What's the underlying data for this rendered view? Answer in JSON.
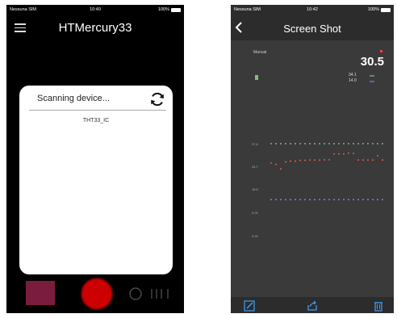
{
  "left_phone": {
    "status": {
      "carrier": "Nessuna SIM",
      "time": "10:40",
      "battery": "100%"
    },
    "title": "HTMercury33",
    "dialog": {
      "title": "Scanning device...",
      "devices": [
        "THT33_IC"
      ]
    },
    "icons": [
      "menu-icon",
      "refresh-icon",
      "record-icon"
    ]
  },
  "right_phone": {
    "status": {
      "carrier": "Nessuna SIM",
      "time": "10:42",
      "battery": "100%"
    },
    "title": "Screen Shot",
    "mode": "Manual",
    "readout": {
      "main": "30.5",
      "secondary": [
        "34.1",
        "14.0"
      ]
    },
    "y_ticks": [
      "37.6",
      "34.7",
      "18.8",
      "0.00",
      "0.00"
    ],
    "series": [
      {
        "name": "green",
        "color": "#8fd88f",
        "values": [
          37.6,
          37.6,
          37.6,
          37.6,
          37.6,
          37.6,
          37.6,
          37.6,
          37.6,
          37.6,
          37.6,
          37.6,
          37.6,
          37.6,
          37.6,
          37.6,
          37.6,
          37.6,
          37.6,
          37.6,
          37.6,
          37.6,
          37.6,
          37.6
        ]
      },
      {
        "name": "red",
        "color": "#ff6060",
        "values": [
          30.4,
          29.9,
          28.2,
          30.8,
          31.1,
          31.1,
          31.4,
          31.4,
          31.5,
          31.5,
          31.5,
          31.6,
          31.6,
          33.8,
          33.8,
          33.8,
          34.1,
          34.0,
          31.5,
          31.5,
          31.5,
          31.5,
          33.1,
          31.5
        ]
      },
      {
        "name": "blue",
        "color": "#8c8cff",
        "values": [
          16.8,
          16.8,
          16.8,
          16.8,
          16.8,
          16.8,
          16.8,
          16.8,
          16.8,
          16.8,
          16.8,
          16.8,
          16.8,
          16.8,
          16.8,
          16.8,
          16.8,
          16.8,
          16.8,
          16.8,
          16.8,
          16.8,
          16.8,
          16.8
        ]
      }
    ],
    "toolbar": [
      "edit-icon",
      "share-icon",
      "trash-icon"
    ]
  }
}
